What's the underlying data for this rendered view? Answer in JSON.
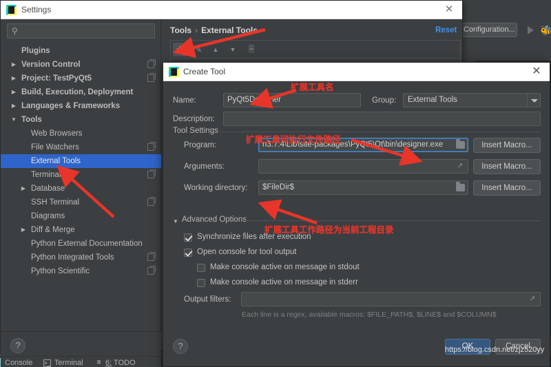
{
  "colors": {
    "accent_blue": "#2f65ca",
    "link_blue": "#3f93e8",
    "ok_button": "#365880",
    "annotation_red": "#e8352a",
    "panel_bg": "#3c3f41",
    "field_bg": "#45494a"
  },
  "ide": {
    "run_configuration_label": "Configuration...",
    "run_icon": "play-icon",
    "debug_icon": "bug-icon"
  },
  "settings_window": {
    "title": "Settings",
    "logo_icon": "pycharm-logo-icon",
    "close_icon": "close-icon",
    "search": {
      "icon": "search-icon",
      "value": "",
      "placeholder": ""
    },
    "tree": [
      {
        "label": "Plugins",
        "level": 0,
        "arrow": "",
        "copy_icon": false,
        "selected": false
      },
      {
        "label": "Version Control",
        "level": 0,
        "arrow": "▶",
        "copy_icon": true,
        "selected": false
      },
      {
        "label": "Project: TestPyQt5",
        "level": 0,
        "arrow": "▶",
        "copy_icon": true,
        "selected": false
      },
      {
        "label": "Build, Execution, Deployment",
        "level": 0,
        "arrow": "▶",
        "copy_icon": false,
        "selected": false
      },
      {
        "label": "Languages & Frameworks",
        "level": 0,
        "arrow": "▶",
        "copy_icon": false,
        "selected": false
      },
      {
        "label": "Tools",
        "level": 0,
        "arrow": "▼",
        "copy_icon": false,
        "selected": false
      },
      {
        "label": "Web Browsers",
        "level": 1,
        "arrow": "",
        "copy_icon": false,
        "selected": false
      },
      {
        "label": "File Watchers",
        "level": 1,
        "arrow": "",
        "copy_icon": true,
        "selected": false
      },
      {
        "label": "External Tools",
        "level": 1,
        "arrow": "",
        "copy_icon": false,
        "selected": true
      },
      {
        "label": "Terminal",
        "level": 1,
        "arrow": "",
        "copy_icon": true,
        "selected": false
      },
      {
        "label": "Database",
        "level": 1,
        "arrow": "▶",
        "copy_icon": false,
        "selected": false
      },
      {
        "label": "SSH Terminal",
        "level": 1,
        "arrow": "",
        "copy_icon": true,
        "selected": false
      },
      {
        "label": "Diagrams",
        "level": 1,
        "arrow": "",
        "copy_icon": false,
        "selected": false
      },
      {
        "label": "Diff & Merge",
        "level": 1,
        "arrow": "▶",
        "copy_icon": false,
        "selected": false
      },
      {
        "label": "Python External Documentation",
        "level": 1,
        "arrow": "",
        "copy_icon": false,
        "selected": false
      },
      {
        "label": "Python Integrated Tools",
        "level": 1,
        "arrow": "",
        "copy_icon": true,
        "selected": false
      },
      {
        "label": "Python Scientific",
        "level": 1,
        "arrow": "",
        "copy_icon": true,
        "selected": false
      }
    ],
    "help_icon": "help-icon",
    "breadcrumb": {
      "root": "Tools",
      "separator": "›",
      "current": "External Tools"
    },
    "reset_label": "Reset",
    "toolbar": {
      "add_icon": "plus-icon",
      "edit_icon": "pencil-icon",
      "move_up_icon": "chevron-up-icon",
      "move_down_icon": "chevron-down-icon",
      "copy_icon": "copy-icon"
    }
  },
  "create_tool_dialog": {
    "title": "Create Tool",
    "logo_icon": "pycharm-logo-icon",
    "close_icon": "close-icon",
    "fields": {
      "name_label": "Name:",
      "name_value": "PyQt5Designer",
      "group_label": "Group:",
      "group_value": "External Tools",
      "group_dropdown_icon": "chevron-down-icon",
      "description_label": "Description:",
      "description_value": ""
    },
    "tool_settings": {
      "section_label": "Tool Settings",
      "program_label": "Program:",
      "program_value": "n3.7.4\\Lib\\site-packages\\PyQt5\\Qt\\bin\\designer.exe",
      "program_browse_icon": "folder-icon",
      "arguments_label": "Arguments:",
      "arguments_value": "",
      "arguments_expand_icon": "expand-icon",
      "working_directory_label": "Working directory:",
      "working_directory_value": "$FileDir$",
      "working_directory_browse_icon": "folder-icon",
      "insert_macro_label": "Insert Macro..."
    },
    "advanced_options": {
      "section_label": "Advanced Options",
      "section_arrow_icon": "triangle-down-icon",
      "checkboxes": [
        {
          "label": "Synchronize files after execution",
          "checked": true,
          "indent": 0
        },
        {
          "label": "Open console for tool output",
          "checked": true,
          "indent": 0
        },
        {
          "label": "Make console active on message in stdout",
          "checked": false,
          "indent": 1
        },
        {
          "label": "Make console active on message in stderr",
          "checked": false,
          "indent": 1
        }
      ],
      "output_filters_label": "Output filters:",
      "output_filters_value": "",
      "output_filters_expand_icon": "expand-icon",
      "hint": "Each line is a regex, available macros: $FILE_PATH$, $LINE$ and $COLUMN$"
    },
    "help_icon": "help-icon",
    "ok_label": "OK",
    "cancel_label": "Cancel"
  },
  "bottom_tool_bar": [
    {
      "label": "Console",
      "icon": "",
      "prefix": ""
    },
    {
      "label": "Terminal",
      "icon": "terminal-icon",
      "prefix": ""
    },
    {
      "label": "TODO",
      "icon": "todo-icon",
      "prefix": "6:"
    }
  ],
  "annotations": [
    {
      "id": "anno-external-tools",
      "text": ""
    },
    {
      "id": "anno-plus-button",
      "text": ""
    },
    {
      "id": "anno-tool-name",
      "text": "扩展工具名"
    },
    {
      "id": "anno-program-path",
      "text": "扩展工具可执行文件路径"
    },
    {
      "id": "anno-working-dir",
      "text": "扩展工具工作路径为当前工程目录"
    }
  ],
  "watermark": {
    "text": "https://blog.csdn.net/zjz520yy"
  }
}
